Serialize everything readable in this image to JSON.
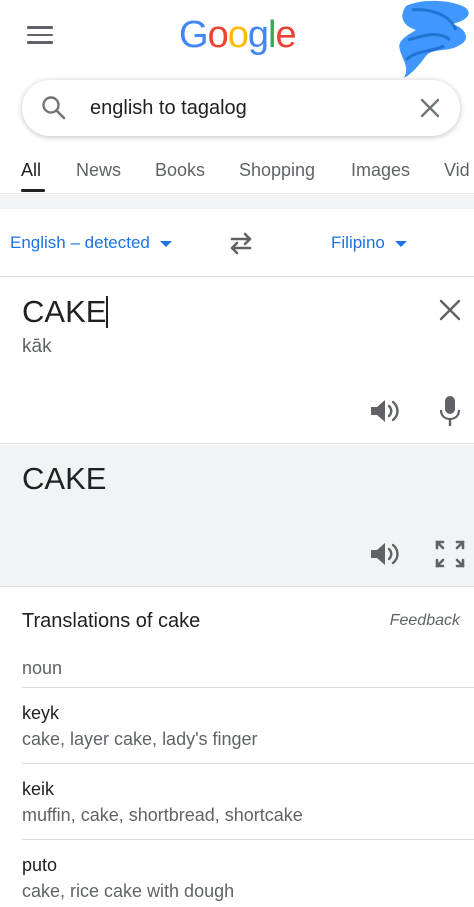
{
  "header": {
    "menu_icon": "hamburger-menu-icon",
    "logo_letters": [
      "G",
      "o",
      "o",
      "g",
      "l",
      "e"
    ]
  },
  "search": {
    "query": "english to tagalog",
    "search_icon": "search-icon",
    "clear_icon": "close-icon"
  },
  "tabs": [
    {
      "label": "All",
      "active": true
    },
    {
      "label": "News"
    },
    {
      "label": "Books"
    },
    {
      "label": "Shopping"
    },
    {
      "label": "Images"
    },
    {
      "label": "Vid"
    }
  ],
  "translator": {
    "source_language": "English – detected",
    "target_language": "Filipino",
    "swap_icon": "swap-arrows-icon",
    "source_text": "CAKE",
    "transliteration": "kāk",
    "target_text": "CAKE"
  },
  "translations": {
    "title": "Translations of cake",
    "feedback_label": "Feedback",
    "part_of_speech": "noun",
    "entries": [
      {
        "word": "keyk",
        "synonyms": "cake, layer cake, lady's finger"
      },
      {
        "word": "keik",
        "synonyms": "muffin, cake, shortbread, shortcake"
      },
      {
        "word": "puto",
        "synonyms": "cake, rice cake with dough"
      }
    ]
  },
  "colors": {
    "accent_blue": "#1a73e8",
    "panel_gray": "#f1f3f4",
    "scribble_blue": "#1e90ff"
  }
}
